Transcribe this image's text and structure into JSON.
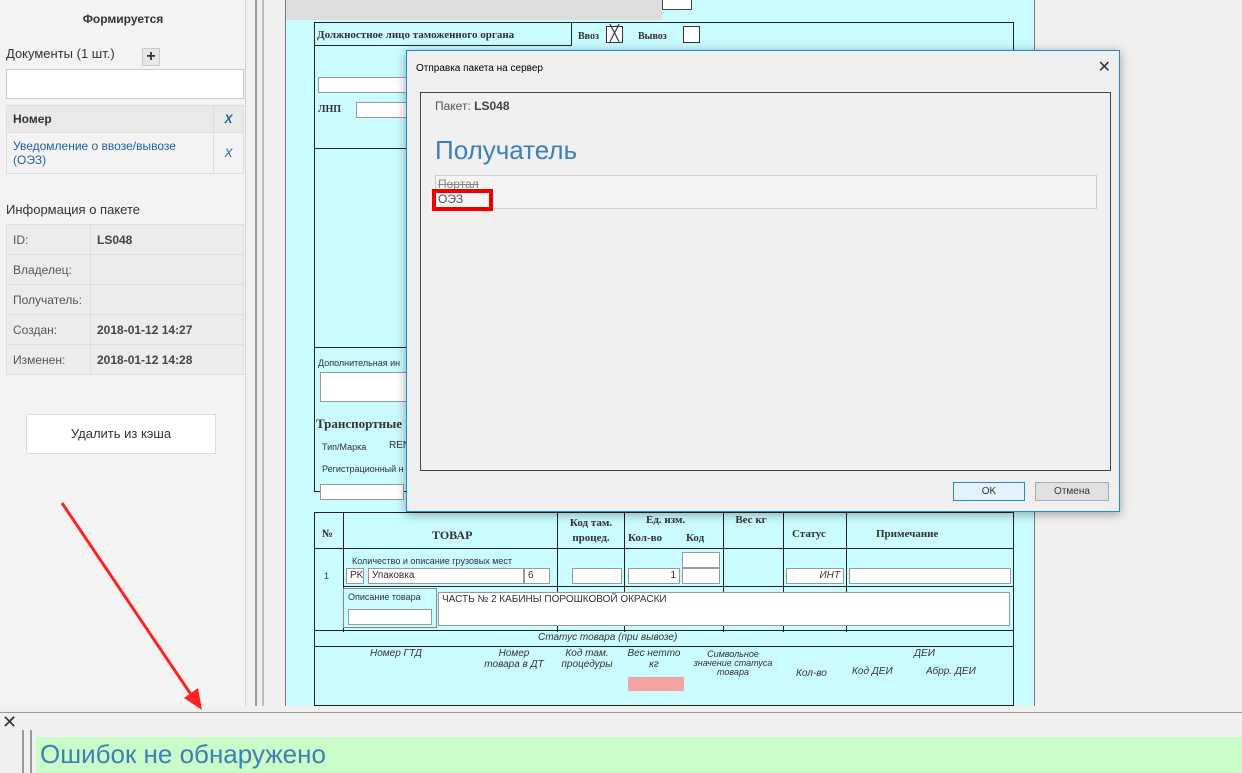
{
  "sidebar": {
    "status": "Формируется",
    "documents_label": "Документы (1 шт.)",
    "add_icon": "plus-icon",
    "doc_table": {
      "header": "Номер",
      "header_remove": "X",
      "row_label": "Уведомление о ввозе/вывозе (ОЭЗ)",
      "row_remove": "X"
    },
    "info_header": "Информация о пакете",
    "info": [
      {
        "k": "ID:",
        "v": "LS048"
      },
      {
        "k": "Владелец:",
        "v": ""
      },
      {
        "k": "Получатель:",
        "v": ""
      },
      {
        "k": "Создан:",
        "v": "2018-01-12 14:27"
      },
      {
        "k": "Изменен:",
        "v": "2018-01-12 14:28"
      }
    ],
    "delete_button": "Удалить из кэша"
  },
  "form": {
    "official": "Должностное лицо таможенного органа",
    "import": "Ввоз",
    "export": "Вывоз",
    "lnp": "ЛНП",
    "additional": "Дополнительная ин",
    "transport": "Транспортные",
    "type_brand": "Тип/Марка",
    "type_value": "REN",
    "reg": "Регистрационный н",
    "goods_table": {
      "no": "№",
      "goods": "ТОВАР",
      "proc_code": "Код там. процед.",
      "unit": "Ед. изм.",
      "qty": "Кол-во",
      "code": "Код",
      "weight": "Вес кг",
      "status": "Статус",
      "note": "Примечание"
    },
    "row": {
      "num": "1",
      "places_label": "Количество и описание грузовых мест",
      "pk": "PK",
      "pack": "Упаковка",
      "pack_qty": "6",
      "qty": "1",
      "status": "ИНТ",
      "desc_label": "Описание товара",
      "desc_value": "ЧАСТЬ № 2 КАБИНЫ ПОРОШКОВОЙ ОКРАСКИ"
    },
    "export_status": "Статус товара (при вывозе)",
    "sub": {
      "gtd": "Номер ГТД",
      "item_dt": "Номер товара в ДТ",
      "proc": "Код там. процедуры",
      "net": "Вес нетто кг",
      "symbol": "Символьное значение статуса товара",
      "dei": "ДЕИ",
      "dei_qty": "Кол-во",
      "dei_code": "Код ДЕИ",
      "dei_abbr": "Абрр. ДЕИ"
    }
  },
  "modal": {
    "title": "Отправка пакета на сервер",
    "package_label": "Пакет:",
    "package_id": "LS048",
    "recipient_heading": "Получатель",
    "portal_label": "Портал",
    "portal_value": "ОЭЗ",
    "ok": "OK",
    "cancel": "Отмена"
  },
  "bottom": {
    "message": "Ошибок не обнаружено"
  },
  "colors": {
    "form_bg": "#c9fbff",
    "success_bg": "#c9fcc9",
    "accent_blue": "#3f7fb4",
    "highlight_red": "#e00000"
  }
}
